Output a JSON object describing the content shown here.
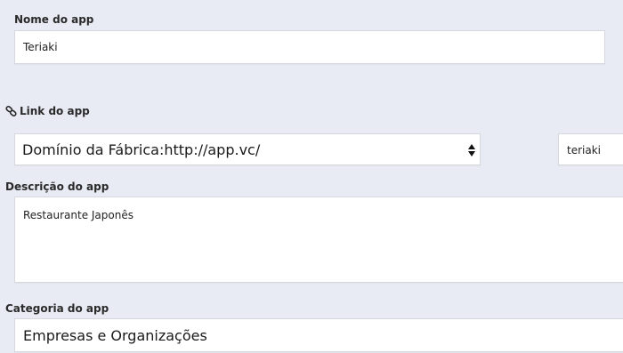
{
  "app_name": {
    "label": "Nome do app",
    "value": "Teriaki"
  },
  "app_link": {
    "label": "Link do app",
    "icon": "link-icon",
    "domain_selected": "Domínio da Fábrica:http://app.vc/",
    "slug_value": "teriaki"
  },
  "app_description": {
    "label": "Descrição do app",
    "value": "Restaurante Japonês"
  },
  "app_category": {
    "label": "Categoria do app",
    "value": "Empresas e Organizações"
  }
}
